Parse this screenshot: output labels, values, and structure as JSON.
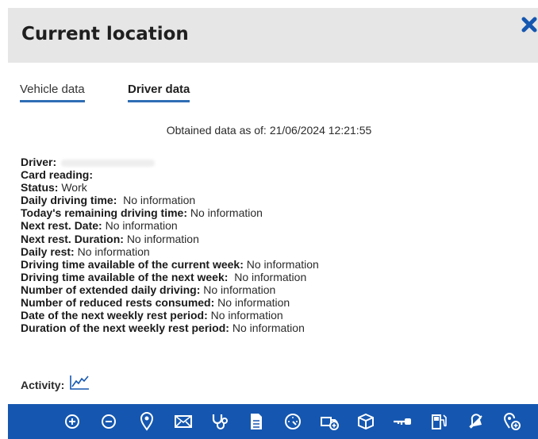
{
  "header": {
    "title": "Current location"
  },
  "tabs": [
    {
      "label": "Vehicle data"
    },
    {
      "label": "Driver data"
    }
  ],
  "obtained": {
    "label": "Obtained data as of:",
    "value": "21/06/2024 12:21:55"
  },
  "fields": [
    {
      "label": "Driver:",
      "value": ""
    },
    {
      "label": "Card reading:",
      "value": ""
    },
    {
      "label": "Status:",
      "value": "Work"
    },
    {
      "label": "Daily driving time:",
      "value": "No information"
    },
    {
      "label": "Today's remaining driving time:",
      "value": "No information"
    },
    {
      "label": "Next rest. Date:",
      "value": "No information"
    },
    {
      "label": "Next rest. Duration:",
      "value": "No information"
    },
    {
      "label": "Daily rest:",
      "value": "No information"
    },
    {
      "label": "Driving time available of the current week:",
      "value": "No information"
    },
    {
      "label": "Driving time available of the next week:",
      "value": "No information"
    },
    {
      "label": "Number of extended daily driving:",
      "value": "No information"
    },
    {
      "label": "Number of reduced rests consumed:",
      "value": "No information"
    },
    {
      "label": "Date of the next weekly rest period:",
      "value": "No information"
    },
    {
      "label": "Duration of the next weekly rest period:",
      "value": "No information"
    }
  ],
  "activity": {
    "label": "Activity:"
  },
  "colors": {
    "accent": "#1557b0",
    "tab_underline": "#2f6db5",
    "header_bg": "#e6e6e6"
  },
  "toolbar": {
    "icons": [
      "zoom-in-icon",
      "zoom-out-icon",
      "location-pin-icon",
      "mail-icon",
      "stethoscope-icon",
      "document-icon",
      "speedometer-icon",
      "add-vehicle-icon",
      "package-icon",
      "key-icon",
      "fuel-pump-icon",
      "bell-icon",
      "add-location-icon"
    ]
  }
}
